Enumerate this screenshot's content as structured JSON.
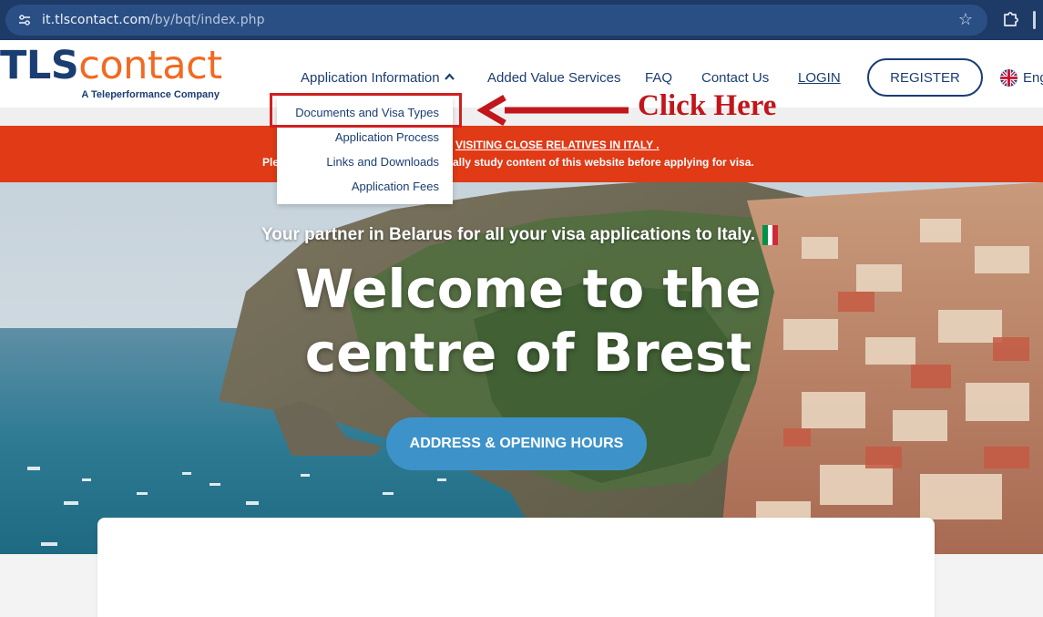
{
  "browser": {
    "url_host": "it.tlscontact.com",
    "url_path": "/by/bqt/index.php"
  },
  "header": {
    "logo_tls": "TLS",
    "logo_contact": "contact",
    "logo_tagline": "A Teleperformance Company",
    "nav": {
      "application_information": "Application Information",
      "added_value_services": "Added Value Services",
      "faq": "FAQ",
      "contact_us": "Contact Us",
      "login": "LOGIN"
    },
    "register_label": "REGISTER",
    "language_label": "Eng"
  },
  "dropdown": {
    "items": [
      {
        "label": "Documents and Visa Types"
      },
      {
        "label": "Application Process"
      },
      {
        "label": "Links and Downloads"
      },
      {
        "label": "Application Fees"
      }
    ]
  },
  "annotation": {
    "text": "Click Here",
    "color": "#c1161b"
  },
  "banner": {
    "line1_visible": "VISITING CLOSE RELATIVES IN ITALY",
    "line1_suffix": ".",
    "line2_left_visible": "Ple",
    "line2_visible": "ally study content of this website before applying for visa.",
    "color": "#e03a16"
  },
  "hero": {
    "tagline": "Your partner in Belarus for all your visa applications to Italy.",
    "headline_line1": "Welcome to the",
    "headline_line2": "centre of Brest",
    "cta_label": "ADDRESS & OPENING HOURS",
    "cta_color": "#3d93c9"
  },
  "colors": {
    "brand_navy": "#1a3d72",
    "brand_orange": "#f26a21"
  }
}
